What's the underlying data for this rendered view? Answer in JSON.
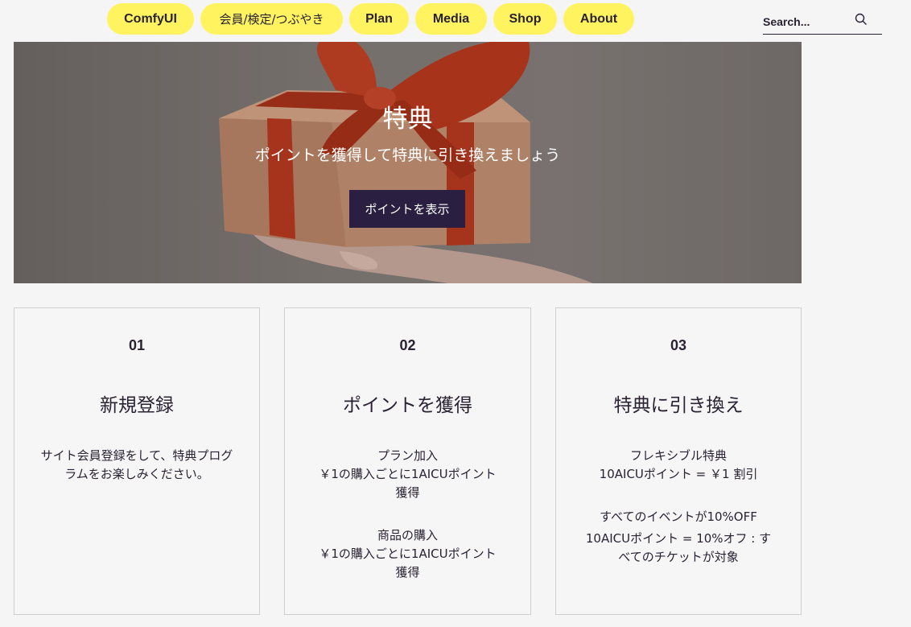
{
  "nav": {
    "items": [
      {
        "label": "ComfyUI"
      },
      {
        "label": "会員/検定/つぶやき"
      },
      {
        "label": "Plan"
      },
      {
        "label": "Media"
      },
      {
        "label": "Shop"
      },
      {
        "label": "About"
      }
    ],
    "search_placeholder": "Search..."
  },
  "hero": {
    "title": "特典",
    "subtitle": "ポイントを獲得して特典に引き換えましょう",
    "button": "ポイントを表示"
  },
  "cards": [
    {
      "num": "01",
      "title": "新規登録",
      "lines": [
        "サイト会員登録をして、特典プログラムをお楽しみください。"
      ]
    },
    {
      "num": "02",
      "title": "ポイントを獲得",
      "lines": [
        "プラン加入",
        "￥1の購入ごとに1AICUポイント獲得",
        "商品の購入",
        "￥1の購入ごとに1AICUポイント獲得"
      ]
    },
    {
      "num": "03",
      "title": "特典に引き換え",
      "lines": [
        "フレキシブル特典",
        "10AICUポイント =  ￥1 割引",
        "すべてのイベントが10%OFF",
        "10AICUポイント = 10%オフ  :  すべてのチケットが対象"
      ]
    }
  ],
  "colors": {
    "pill": "#fff45f",
    "button": "#2a1f40",
    "text": "#2a2233"
  }
}
